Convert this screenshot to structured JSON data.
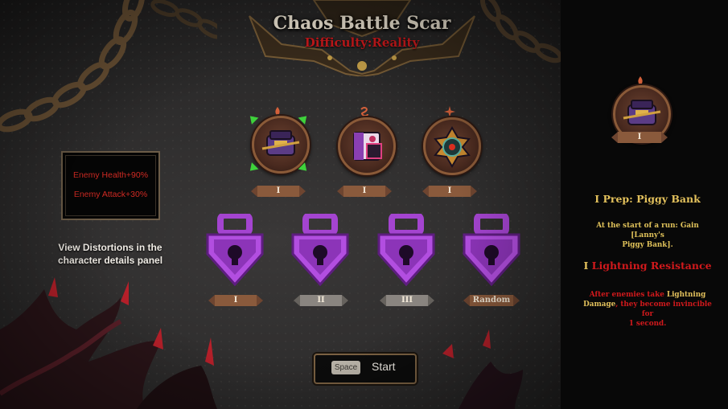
{
  "header": {
    "title": "Chaos Battle Scar",
    "difficulty": "Difficulty:Reality"
  },
  "stats": {
    "lines": [
      "Enemy Health+90%",
      "Enemy Attack+30%"
    ]
  },
  "hint_text": "View Distortions in the character details panel",
  "relics": [
    {
      "name": "piggy-bank-relic",
      "level": "I",
      "selected": true
    },
    {
      "name": "spellbook-relic",
      "level": "I",
      "selected": false
    },
    {
      "name": "compass-relic",
      "level": "I",
      "selected": false
    }
  ],
  "locks": [
    {
      "name": "lock-1",
      "label": "I",
      "style": "brown"
    },
    {
      "name": "lock-2",
      "label": "II",
      "style": "grey"
    },
    {
      "name": "lock-3",
      "label": "III",
      "style": "grey"
    },
    {
      "name": "lock-4",
      "label": "Random",
      "style": "brown"
    }
  ],
  "start_button": {
    "key": "Space",
    "label": "Start"
  },
  "side_panel": {
    "relic_level": "I",
    "entry1": {
      "numeral": "I",
      "title": "Prep: Piggy Bank",
      "desc_a": "At the start of a run: Gain [Lanny's",
      "desc_b": "Piggy Bank]."
    },
    "entry2": {
      "numeral": "I",
      "title": "Lightning Resistance",
      "desc_1a": "After enemies take",
      "desc_1b": "Lightning",
      "desc_2a": "Damage",
      "desc_2b": ", they become invincible for",
      "desc_3": "1 second."
    }
  },
  "colors": {
    "accent_red": "#d1191c",
    "gold": "#e3c15c",
    "lock_purple": "#b050d8",
    "select_green": "#3ed23b"
  }
}
